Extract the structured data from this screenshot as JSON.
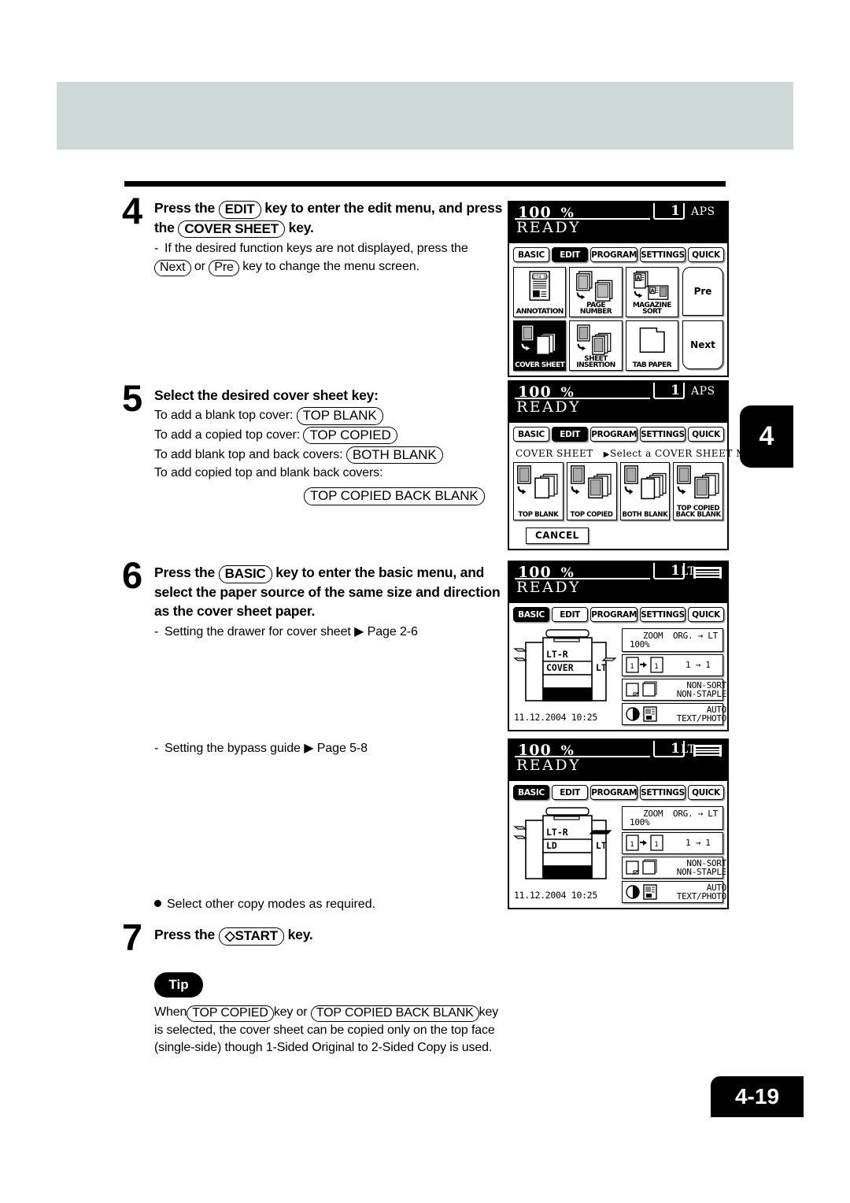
{
  "page": {
    "chapter_tab": "4",
    "page_number": "4-19"
  },
  "steps": [
    {
      "number": "4",
      "head_parts": [
        "Press the ",
        "EDIT",
        " key to enter the edit menu, and press the ",
        "COVER SHEET",
        " key."
      ],
      "head_pre": "Press the",
      "key1": "EDIT",
      "head_mid": "key to enter the edit menu, and press the",
      "key2": "COVER SHEET",
      "head_post": "key.",
      "sub_pre": "If the desired function keys are not displayed, press the",
      "sub_key1": "Next",
      "sub_or": "or",
      "sub_key2": "Pre",
      "sub_post": "key to change the menu screen."
    },
    {
      "number": "5",
      "head": "Select the desired cover sheet key:",
      "lines": [
        {
          "text": "To add a blank top cover:",
          "key": "TOP BLANK"
        },
        {
          "text": "To add a copied top cover:",
          "key": "TOP COPIED"
        },
        {
          "text": "To add blank top and back covers:",
          "key": "BOTH BLANK"
        },
        {
          "text": "To add copied top and blank back covers:",
          "key": ""
        }
      ],
      "last_key": "TOP COPIED BACK BLANK"
    },
    {
      "number": "6",
      "head_pre": "Press the",
      "key1": "BASIC",
      "head_post": "key to enter the basic menu, and select the paper source of the same size and direction as the cover sheet paper.",
      "sub1": "Setting the drawer for cover sheet",
      "sub1_ref": "Page 2-6",
      "sub2": "Setting the bypass guide",
      "sub2_ref": "Page 5-8"
    },
    {
      "number": "7",
      "bullet": "Select other copy modes as required.",
      "head_pre": "Press the",
      "key1": "START",
      "head_post": "key."
    }
  ],
  "tip": {
    "badge": "Tip",
    "pre": "When",
    "key1": "TOP COPIED",
    "mid1": "key or",
    "key2": "TOP COPIED BACK BLANK",
    "mid2": "key",
    "body": "is selected, the cover sheet can be copied only on the top face (single-side) though 1-Sided Original to 2-Sided Copy is used."
  },
  "lcd_common": {
    "ratio": "100",
    "percent": "%",
    "count": "1",
    "aps": "APS",
    "ready": "READY",
    "lt": "LT",
    "tabs": [
      "BASIC",
      "EDIT",
      "PROGRAM",
      "SETTINGS",
      "QUICK"
    ]
  },
  "lcd_panels": [
    {
      "id": "edit-menu",
      "selected_tab": "EDIT",
      "status_right": "APS",
      "icons": [
        {
          "label": "ANNOTATION",
          "selected": false,
          "art": "annotation-icon"
        },
        {
          "label": "PAGE NUMBER",
          "selected": false,
          "art": "page-number-icon"
        },
        {
          "label": "MAGAZINE SORT",
          "selected": false,
          "art": "magazine-sort-icon"
        },
        {
          "label": "COVER SHEET",
          "selected": true,
          "art": "cover-sheet-icon"
        },
        {
          "label": "SHEET INSERTION",
          "selected": false,
          "art": "sheet-insertion-icon"
        },
        {
          "label": "TAB PAPER",
          "selected": false,
          "art": "tab-paper-icon"
        }
      ],
      "nav": {
        "prev": "Pre",
        "next": "Next"
      }
    },
    {
      "id": "cover-sheet-mode",
      "selected_tab": "EDIT",
      "status_right": "APS",
      "title": "COVER SHEET",
      "title_hint": "Select a COVER SHEET MODE",
      "modes": [
        {
          "label": "TOP BLANK",
          "art": "top-blank-icon"
        },
        {
          "label": "TOP COPIED",
          "art": "top-copied-icon"
        },
        {
          "label": "BOTH BLANK",
          "art": "both-blank-icon"
        },
        {
          "label": "TOP COPIED BACK BLANK",
          "art": "top-copied-back-blank-icon"
        }
      ],
      "cancel": "CANCEL"
    },
    {
      "id": "basic-menu-cover",
      "selected_tab": "BASIC",
      "status_right": "LT",
      "drawers": [
        {
          "label": "LT-R",
          "selected": false
        },
        {
          "label": "COVER",
          "selected": false
        },
        {
          "label": "LT",
          "selected": true
        }
      ],
      "side_label": "LT",
      "datetime": "11.12.2004 10:25",
      "settings": [
        {
          "line1": "ZOOM",
          "line2": "100%",
          "right": "ORG. → LT"
        },
        {
          "right": "1 → 1"
        },
        {
          "line1": "NON-SORT",
          "line2": "NON-STAPLE"
        },
        {
          "line1": "AUTO",
          "line2": "TEXT/PHOTO"
        }
      ]
    },
    {
      "id": "basic-menu-ld",
      "selected_tab": "BASIC",
      "status_right": "LT",
      "drawers": [
        {
          "label": "LT-R",
          "selected": false
        },
        {
          "label": "LD",
          "selected": false
        },
        {
          "label": "LT",
          "selected": true
        }
      ],
      "side_label": "LT",
      "datetime": "11.12.2004 10:25",
      "settings": [
        {
          "line1": "ZOOM",
          "line2": "100%",
          "right": "ORG. → LT"
        },
        {
          "right": "1 → 1"
        },
        {
          "line1": "NON-SORT",
          "line2": "NON-STAPLE"
        },
        {
          "line1": "AUTO",
          "line2": "TEXT/PHOTO"
        }
      ]
    }
  ]
}
